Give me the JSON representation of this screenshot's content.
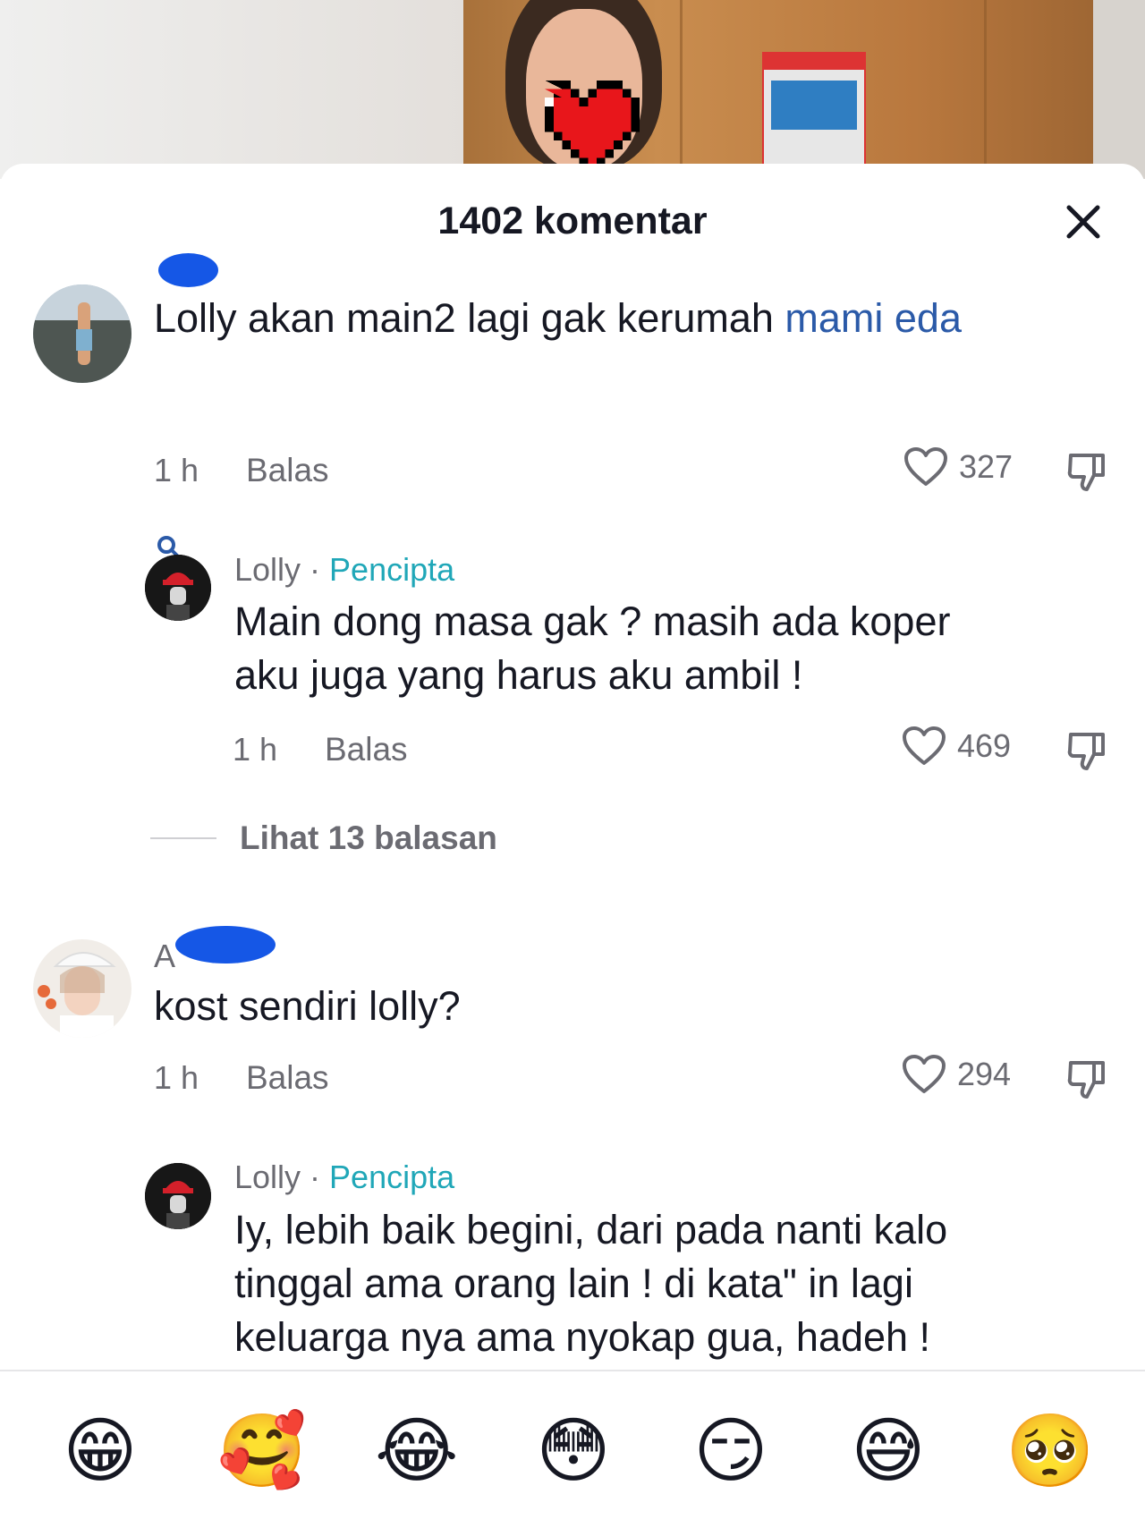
{
  "sheet": {
    "title": "1402 komentar"
  },
  "comments": [
    {
      "username": "",
      "text": "Lolly akan main2 lagi gak kerumah ",
      "mention": "mami eda",
      "time": "1 h",
      "reply_label": "Balas",
      "likes": "327"
    },
    {
      "username": "Lolly",
      "separator": " · ",
      "badge": "Pencipta",
      "text_lines": [
        "Main dong masa gak ? masih ada koper",
        "aku juga yang harus aku ambil !"
      ],
      "time": "1 h",
      "reply_label": "Balas",
      "likes": "469"
    },
    {
      "username": "A",
      "text": "kost sendiri lolly?",
      "time": "1 h",
      "reply_label": "Balas",
      "likes": "294"
    },
    {
      "username": "Lolly",
      "separator": " · ",
      "badge": "Pencipta",
      "text_lines": [
        "Iy, lebih baik begini, dari pada nanti kalo",
        "tinggal ama orang lain ! di kata\" in lagi",
        "keluarga nya ama nyokap gua, hadeh !"
      ]
    }
  ],
  "view_replies": "Lihat 13 balasan",
  "emoji_bar": [
    "😁",
    "🥰",
    "😂",
    "😳",
    "😏",
    "😅",
    "🥺"
  ],
  "colors": {
    "creator": "#20a7b8",
    "mention": "#2b5aa8",
    "redaction": "#1557e6"
  }
}
